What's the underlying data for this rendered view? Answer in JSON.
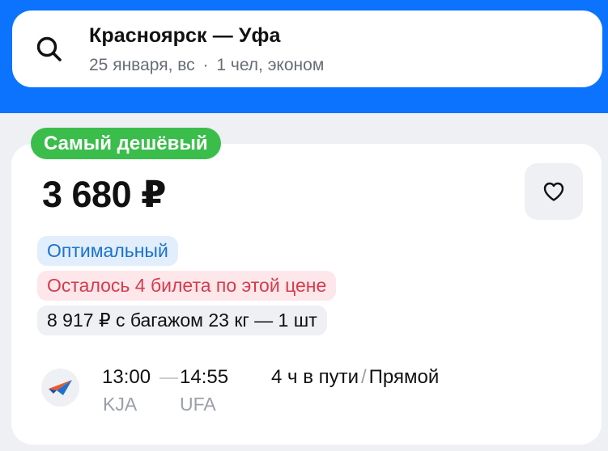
{
  "search": {
    "route": "Красноярск — Уфа",
    "date": "25 января, вс",
    "separator": "·",
    "passengers": "1 чел, эконом"
  },
  "ticket": {
    "badge": "Самый дешёвый",
    "price": "3 680 ₽",
    "tags": {
      "optimal": "Оптимальный",
      "seats_left": "Осталось 4 билета по этой цене",
      "baggage": "8 917 ₽ с багажом 23 кг — 1 шт"
    },
    "departure_time": "13:00",
    "arrival_time": "14:55",
    "departure_airport": "KJA",
    "arrival_airport": "UFA",
    "duration": "4 ч в пути",
    "duration_separator": "/",
    "flight_type": "Прямой"
  },
  "icons": {
    "search": "search-icon",
    "favorite": "heart-icon",
    "airline": "airline-logo"
  },
  "colors": {
    "brand_blue": "#0c73fe",
    "badge_green": "#3bbd4c",
    "optimal_text": "#1a73cd",
    "seats_text": "#d73b4c"
  }
}
